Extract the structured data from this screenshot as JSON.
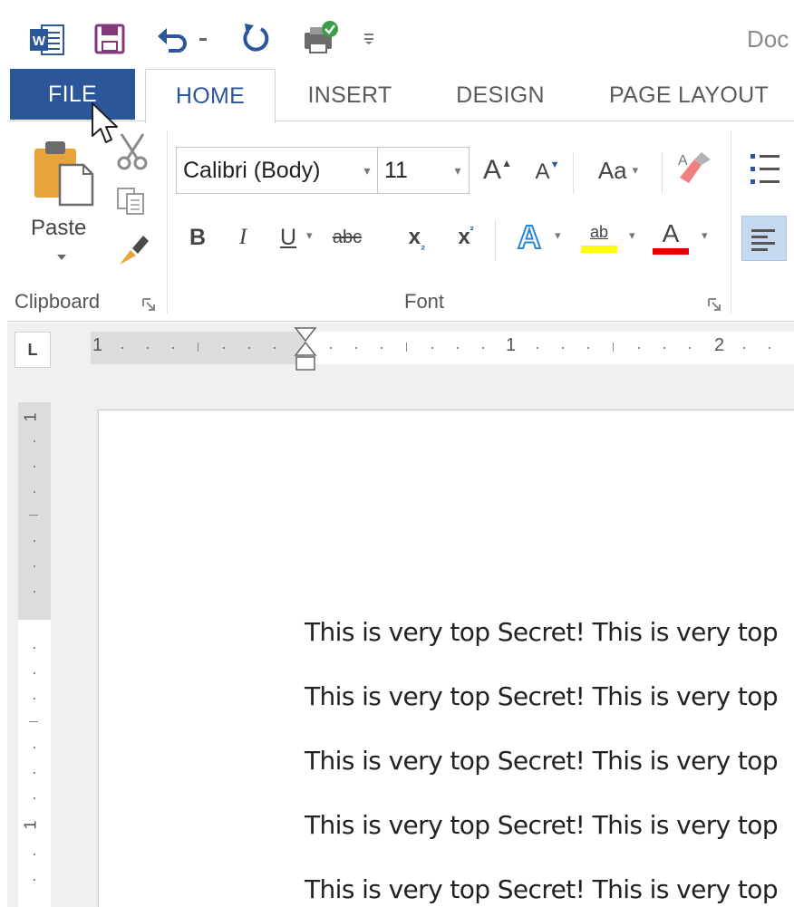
{
  "window": {
    "title": "Doc"
  },
  "quick_access": {
    "icons": [
      "word-app-icon",
      "save-icon",
      "undo-icon",
      "dropdown-caret-icon",
      "redo-icon",
      "touch-mode-icon",
      "customize-qat-icon"
    ]
  },
  "tabs": [
    {
      "label": "FILE"
    },
    {
      "label": "HOME",
      "active": true
    },
    {
      "label": "INSERT"
    },
    {
      "label": "DESIGN"
    },
    {
      "label": "PAGE LAYOUT"
    }
  ],
  "clipboard": {
    "group_label": "Clipboard",
    "paste_label": "Paste"
  },
  "font": {
    "group_label": "Font",
    "font_name": "Calibri (Body)",
    "font_size": "11",
    "grow_label": "A",
    "shrink_label": "A",
    "change_case_label": "Aa",
    "bold_label": "B",
    "italic_label": "I",
    "underline_label": "U",
    "strike_label": "abc",
    "subscript_label": "x",
    "superscript_label": "x",
    "effects_label": "A",
    "highlight_label": "ab",
    "font_color_label": "A"
  },
  "ruler": {
    "horizontal_numbers": [
      "1",
      "1",
      "2"
    ],
    "vertical_numbers": [
      "1",
      "1"
    ],
    "tab_selector": "L"
  },
  "document": {
    "lines": [
      "This is very top Secret! This is very top",
      "This is very top Secret! This is very top",
      "This is very top Secret! This is very top",
      "This is very top Secret! This is very top",
      "This is very top Secret! This is very top"
    ]
  },
  "colors": {
    "accent": "#2b579a",
    "save_purple": "#80397b",
    "highlight_yellow": "#ffff00",
    "font_red": "#e00000",
    "paste_orange": "#e8a33a"
  }
}
